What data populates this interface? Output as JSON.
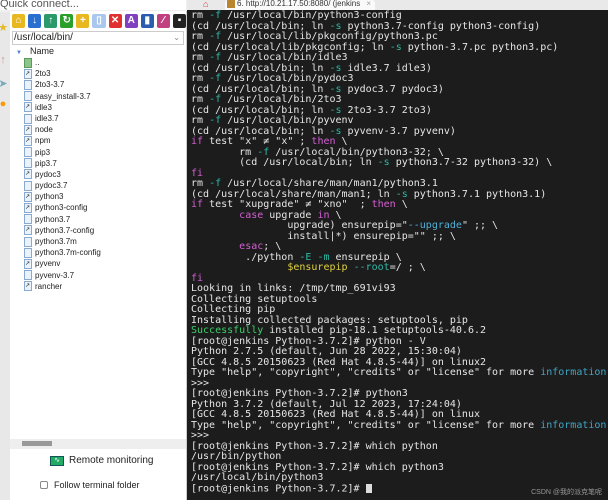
{
  "quick_connect": {
    "placeholder": "Quick connect..."
  },
  "toolbar": {
    "icons": [
      "open-folder-icon",
      "download-icon",
      "upload-icon",
      "refresh-icon",
      "new-folder-icon",
      "new-file-icon",
      "delete-icon",
      "rename-icon",
      "properties-icon",
      "edit-icon",
      "terminal-icon"
    ]
  },
  "path": {
    "value": "/usr/local/bin/"
  },
  "file_list": {
    "column": "Name",
    "items": [
      {
        "name": "..",
        "type": "up"
      },
      {
        "name": "2to3",
        "type": "link"
      },
      {
        "name": "2to3-3.7",
        "type": "file"
      },
      {
        "name": "easy_install-3.7",
        "type": "file"
      },
      {
        "name": "idle3",
        "type": "link"
      },
      {
        "name": "idle3.7",
        "type": "file"
      },
      {
        "name": "node",
        "type": "link"
      },
      {
        "name": "npm",
        "type": "link"
      },
      {
        "name": "pip3",
        "type": "file"
      },
      {
        "name": "pip3.7",
        "type": "file"
      },
      {
        "name": "pydoc3",
        "type": "link"
      },
      {
        "name": "pydoc3.7",
        "type": "file"
      },
      {
        "name": "python3",
        "type": "link"
      },
      {
        "name": "python3-config",
        "type": "link"
      },
      {
        "name": "python3.7",
        "type": "file"
      },
      {
        "name": "python3.7-config",
        "type": "link"
      },
      {
        "name": "python3.7m",
        "type": "file"
      },
      {
        "name": "python3.7m-config",
        "type": "file"
      },
      {
        "name": "pyvenv",
        "type": "link"
      },
      {
        "name": "pyvenv-3.7",
        "type": "file"
      },
      {
        "name": "rancher",
        "type": "link"
      }
    ]
  },
  "bottom": {
    "remote_monitoring": "Remote monitoring",
    "follow_terminal": "Follow terminal folder",
    "follow_checked": false
  },
  "tab": {
    "title": "6. http://10.21.17.50:8080/ (jenkins"
  },
  "colors": {
    "terminal_bg": "#1c1c1c",
    "flag": "#2fb8a6",
    "keyword": "#d35fd3",
    "success": "#3ccf6a",
    "info": "#3fa6c6",
    "variable": "#e0d040"
  },
  "terminal": {
    "lines": [
      [
        [
          "rm ",
          ""
        ],
        [
          "-f",
          "flag"
        ],
        [
          " /usr/local/bin/python3-config",
          ""
        ]
      ],
      [
        [
          "(cd /usr/local/bin; ln ",
          ""
        ],
        [
          "-s",
          "flag"
        ],
        [
          " python3.7-config python3-config)",
          ""
        ]
      ],
      [
        [
          "rm ",
          ""
        ],
        [
          "-f",
          "flag"
        ],
        [
          " /usr/local/lib/pkgconfig/python3.pc",
          ""
        ]
      ],
      [
        [
          "(cd /usr/local/lib/pkgconfig; ln ",
          ""
        ],
        [
          "-s",
          "flag"
        ],
        [
          " python-3.7.pc python3.pc)",
          ""
        ]
      ],
      [
        [
          "rm ",
          ""
        ],
        [
          "-f",
          "flag"
        ],
        [
          " /usr/local/bin/idle3",
          ""
        ]
      ],
      [
        [
          "(cd /usr/local/bin; ln ",
          ""
        ],
        [
          "-s",
          "flag"
        ],
        [
          " idle3.7 idle3)",
          ""
        ]
      ],
      [
        [
          "rm ",
          ""
        ],
        [
          "-f",
          "flag"
        ],
        [
          " /usr/local/bin/pydoc3",
          ""
        ]
      ],
      [
        [
          "(cd /usr/local/bin; ln ",
          ""
        ],
        [
          "-s",
          "flag"
        ],
        [
          " pydoc3.7 pydoc3)",
          ""
        ]
      ],
      [
        [
          "rm ",
          ""
        ],
        [
          "-f",
          "flag"
        ],
        [
          " /usr/local/bin/2to3",
          ""
        ]
      ],
      [
        [
          "(cd /usr/local/bin; ln ",
          ""
        ],
        [
          "-s",
          "flag"
        ],
        [
          " 2to3-3.7 2to3)",
          ""
        ]
      ],
      [
        [
          "rm ",
          ""
        ],
        [
          "-f",
          "flag"
        ],
        [
          " /usr/local/bin/pyvenv",
          ""
        ]
      ],
      [
        [
          "(cd /usr/local/bin; ln ",
          ""
        ],
        [
          "-s",
          "flag"
        ],
        [
          " pyvenv-3.7 pyvenv)",
          ""
        ]
      ],
      [
        [
          "if",
          "kw"
        ],
        [
          " test \"x\" ≠ \"x\" ; ",
          ""
        ],
        [
          "then",
          "kw"
        ],
        [
          " \\",
          ""
        ]
      ],
      [
        [
          "        rm ",
          ""
        ],
        [
          "-f",
          "flag"
        ],
        [
          " /usr/local/bin/python3-32; \\",
          ""
        ]
      ],
      [
        [
          "        (cd /usr/local/bin; ln ",
          ""
        ],
        [
          "-s",
          "flag"
        ],
        [
          " python3.7-32 python3-32) \\",
          ""
        ]
      ],
      [
        [
          "fi",
          "kw"
        ]
      ],
      [
        [
          "rm ",
          ""
        ],
        [
          "-f",
          "flag"
        ],
        [
          " /usr/local/share/man/man1/python3.1",
          ""
        ]
      ],
      [
        [
          "(cd /usr/local/share/man/man1; ln ",
          ""
        ],
        [
          "-s",
          "flag"
        ],
        [
          " python3.7.1 python3.1)",
          ""
        ]
      ],
      [
        [
          "if",
          "kw"
        ],
        [
          " test \"xupgrade\" ≠ \"xno\"  ; ",
          ""
        ],
        [
          "then",
          "kw"
        ],
        [
          " \\",
          ""
        ]
      ],
      [
        [
          "        ",
          ""
        ],
        [
          "case",
          "kw"
        ],
        [
          " upgrade ",
          ""
        ],
        [
          "in",
          "kw"
        ],
        [
          " \\",
          ""
        ]
      ],
      [
        [
          "                upgrade) ensurepip=\"",
          ""
        ],
        [
          "--upgrade",
          "str"
        ],
        [
          "\" ;; \\",
          ""
        ]
      ],
      [
        [
          "                install|*) ensurepip=\"\" ;; \\",
          ""
        ]
      ],
      [
        [
          "        ",
          ""
        ],
        [
          "esac",
          "kw"
        ],
        [
          "; \\",
          ""
        ]
      ],
      [
        [
          "         ./python ",
          ""
        ],
        [
          "-E",
          "flag"
        ],
        [
          " ",
          ""
        ],
        [
          "-m",
          "flag"
        ],
        [
          " ensurepip \\",
          ""
        ]
      ],
      [
        [
          "                ",
          ""
        ],
        [
          "$ensurepip",
          "var"
        ],
        [
          " ",
          ""
        ],
        [
          "--root",
          "flag"
        ],
        [
          "=/ ; \\",
          ""
        ]
      ],
      [
        [
          "fi",
          "kw"
        ]
      ],
      [
        [
          "Looking in links: /tmp/tmp_691vi93",
          ""
        ]
      ],
      [
        [
          "Collecting setuptools",
          ""
        ]
      ],
      [
        [
          "Collecting pip",
          ""
        ]
      ],
      [
        [
          "Installing collected packages: setuptools, pip",
          ""
        ]
      ],
      [
        [
          "Successfully",
          "ok"
        ],
        [
          " installed pip-18.1 setuptools-40.6.2",
          ""
        ]
      ],
      [
        [
          "[root@jenkins Python-3.7.2]# python - V",
          ""
        ]
      ],
      [
        [
          "Python 2.7.5 (default, Jun 28 2022, 15:30:04)",
          ""
        ]
      ],
      [
        [
          "[GCC 4.8.5 20150623 (Red Hat 4.8.5-44)] on linux2",
          ""
        ]
      ],
      [
        [
          "Type \"help\", \"copyright\", \"credits\" or \"license\" for more ",
          ""
        ],
        [
          "information",
          "info"
        ],
        [
          ".",
          ""
        ]
      ],
      [
        [
          ">>>",
          ""
        ]
      ],
      [
        [
          "[root@jenkins Python-3.7.2]# python3",
          ""
        ]
      ],
      [
        [
          "Python 3.7.2 (default, Jul 12 2023, 17:24:04)",
          ""
        ]
      ],
      [
        [
          "[GCC 4.8.5 20150623 (Red Hat 4.8.5-44)] on linux",
          ""
        ]
      ],
      [
        [
          "Type \"help\", \"copyright\", \"credits\" or \"license\" for more ",
          ""
        ],
        [
          "information",
          "info"
        ],
        [
          ".",
          ""
        ]
      ],
      [
        [
          ">>>",
          ""
        ]
      ],
      [
        [
          "[root@jenkins Python-3.7.2]# which python",
          ""
        ]
      ],
      [
        [
          "/usr/bin/python",
          ""
        ]
      ],
      [
        [
          "[root@jenkins Python-3.7.2]# which python3",
          ""
        ]
      ],
      [
        [
          "/usr/local/bin/python3",
          ""
        ]
      ],
      [
        [
          "[root@jenkins Python-3.7.2]# ",
          ""
        ]
      ]
    ]
  },
  "watermark": "CSDN @我的派克笔呢"
}
